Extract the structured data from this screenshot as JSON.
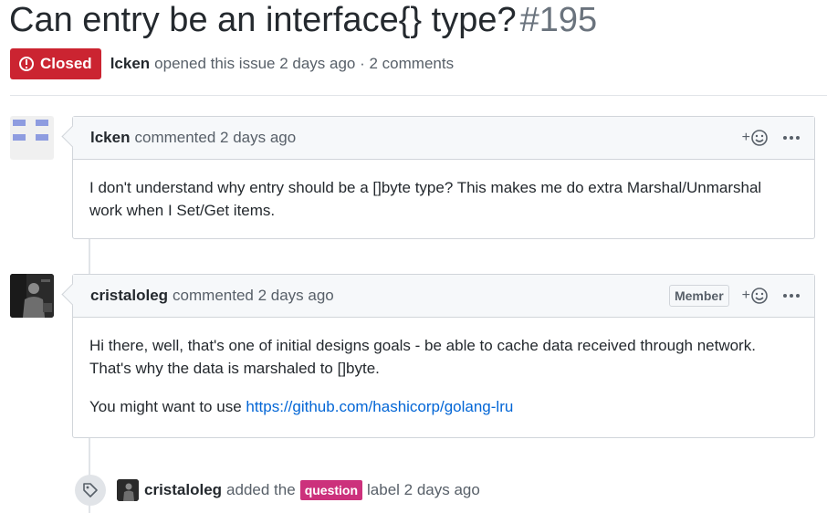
{
  "issue": {
    "title": "Can entry be an interface{} type?",
    "number": "#195",
    "state": "Closed",
    "state_color": "#cb2431",
    "author": "lcken",
    "opened_text": "opened this issue 2 days ago · 2 comments"
  },
  "comments": [
    {
      "author": "lcken",
      "meta": "commented 2 days ago",
      "avatar": "identicon",
      "paragraphs": [
        "I don't understand why entry should be a []byte type? This makes me do extra Marshal/Unmarshal work when I Set/Get items."
      ]
    },
    {
      "author": "cristaloleg",
      "meta": "commented 2 days ago",
      "avatar": "photo",
      "badge": "Member",
      "paragraphs": [
        "Hi there, well, that's one of initial designs goals - be able to cache data received through network. That's why the data is marshaled to []byte."
      ],
      "link_prefix": "You might want to use ",
      "link_text": "https://github.com/hashicorp/golang-lru"
    }
  ],
  "event": {
    "icon": "tag-icon",
    "actor": "cristaloleg",
    "action": "added the",
    "label": "question",
    "label_color": "#cc317c",
    "suffix": "label 2 days ago"
  },
  "icons": {
    "closed": "issue-closed-icon",
    "reaction": "add-reaction-icon",
    "more": "kebab-horizontal-icon"
  }
}
